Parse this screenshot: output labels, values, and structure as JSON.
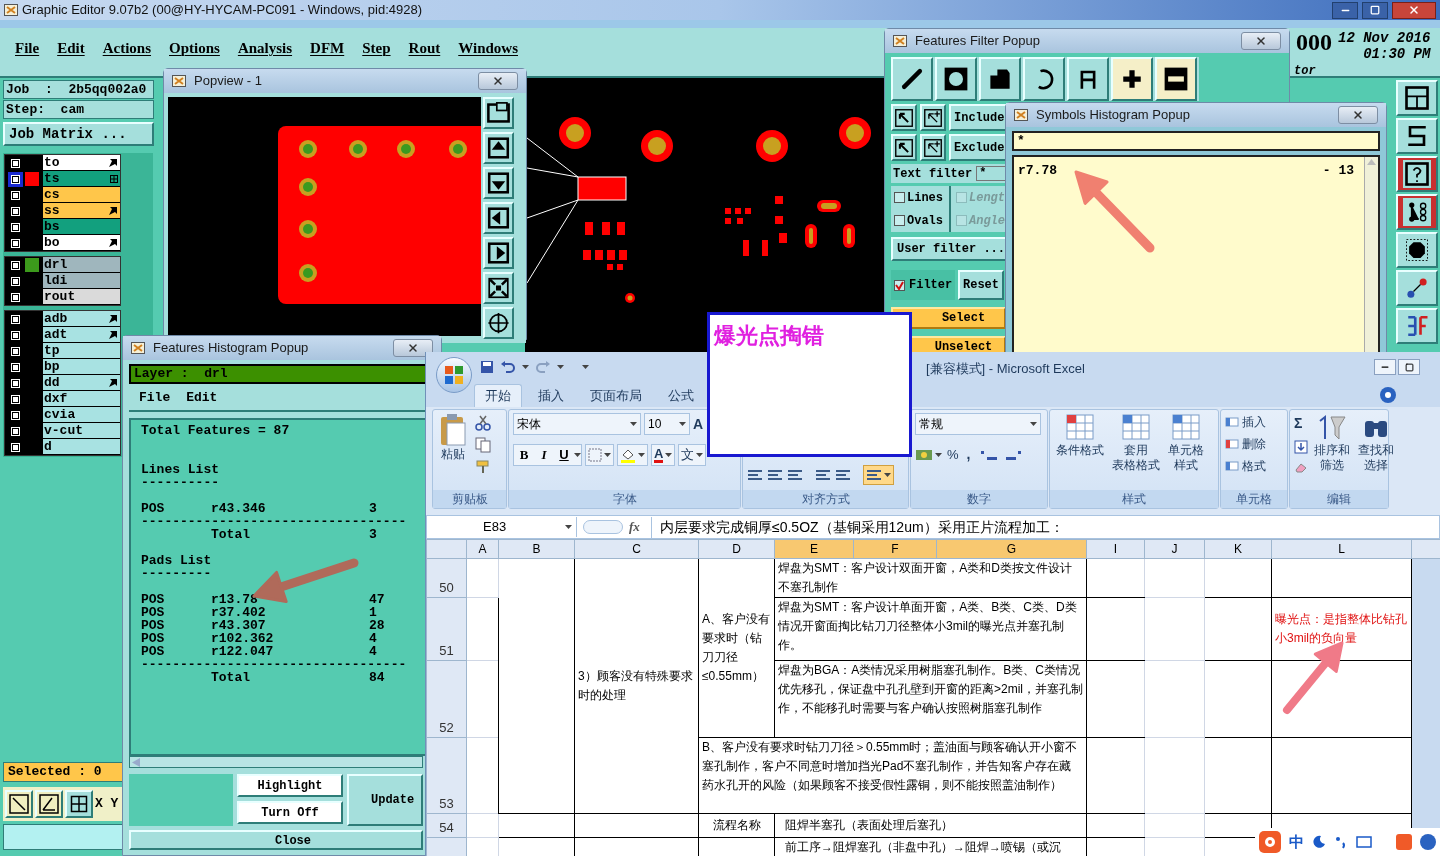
{
  "main_window": {
    "title": "Graphic Editor 9.07b2 (00@HY-HYCAM-PC091 - Windows, pid:4928)"
  },
  "menu": [
    "File",
    "Edit",
    "Actions",
    "Options",
    "Analysis",
    "DFM",
    "Step",
    "Rout",
    "Windows"
  ],
  "header_info": {
    "counter": "000",
    "date": "12 Nov 2016",
    "time": "01:30 PM",
    "label": "tor"
  },
  "job": {
    "job": "Job  :  2b5qq002a0",
    "step": "Step:  cam",
    "matrix_button": "Job Matrix ..."
  },
  "layer_groups": [
    [
      {
        "name": "to",
        "color": "#ffffff",
        "selected": false,
        "marker": {
          "kind": "pointer"
        }
      },
      {
        "name": "ts",
        "color": "#12a07e",
        "selected": true,
        "swatch": {
          "color": "#ff0000"
        },
        "marker": {
          "kind": "grid"
        }
      },
      {
        "name": "cs",
        "color": "#ffc64a",
        "selected": false
      },
      {
        "name": "ss",
        "color": "#ffc64a",
        "selected": false,
        "marker": {
          "kind": "pointer"
        }
      },
      {
        "name": "bs",
        "color": "#12a07e",
        "selected": false
      },
      {
        "name": "bo",
        "color": "#ffffff",
        "selected": false,
        "marker": {
          "kind": "pointer"
        }
      }
    ],
    [
      {
        "name": "drl",
        "color": "#9fb6bd",
        "selected": false,
        "swatch": {
          "color": "#3c9a1c"
        }
      },
      {
        "name": "ldi",
        "color": "#9fb6bd",
        "selected": false
      },
      {
        "name": "rout",
        "color": "#dadada",
        "selected": false
      }
    ],
    [
      {
        "name": "adb",
        "color": "#a8e2e2",
        "selected": false,
        "marker": {
          "kind": "pointer"
        }
      },
      {
        "name": "adt",
        "color": "#a8e2e2",
        "selected": false,
        "marker": {
          "kind": "pointer"
        }
      },
      {
        "name": "tp",
        "color": "#a8e2e2",
        "selected": false
      },
      {
        "name": "bp",
        "color": "#a8e2e2",
        "selected": false
      },
      {
        "name": "dd",
        "color": "#a8e2e2",
        "selected": false,
        "marker": {
          "kind": "pointer"
        }
      },
      {
        "name": "dxf",
        "color": "#a8e2e2",
        "selected": false
      },
      {
        "name": "cvia",
        "color": "#a8e2e2",
        "selected": false
      },
      {
        "name": "v-cut",
        "color": "#a8e2e2",
        "selected": false
      },
      {
        "name": "d",
        "color": "#a8e2e2",
        "selected": false
      }
    ]
  ],
  "selected_count": "Selected : 0",
  "coord_label": "X Y",
  "popview": {
    "title": "Popview - 1"
  },
  "features_filter": {
    "title": "Features Filter Popup",
    "include": "Include",
    "exclude": "Exclude",
    "text_filter_label": "Text filter",
    "text_filter_value": "*",
    "type_checks": [
      {
        "label": "Lines",
        "checked": false
      },
      {
        "label": "Ovals",
        "checked": false
      }
    ],
    "attr_checks": [
      {
        "label": "Lengt",
        "checked": false,
        "disabled": true
      },
      {
        "label": "Angle",
        "checked": false,
        "disabled": true
      }
    ],
    "user_filter": "User filter ...",
    "filter": {
      "label": "Filter",
      "checked": true
    },
    "reset": "Reset",
    "select": "Select",
    "unselect": "Unselect"
  },
  "symbols_histogram": {
    "title": "Symbols Histogram Popup",
    "filter_value": "*",
    "items": [
      {
        "symbol": "r7.78",
        "count": "- 13"
      }
    ]
  },
  "features_histogram": {
    "title": "Features Histogram Popup",
    "layer": "Layer :  drl",
    "menu": [
      "File",
      "Edit"
    ],
    "total_features": "Total Features = 87",
    "sections": [
      {
        "title": "Lines List",
        "underline": "----------",
        "rows": [
          {
            "type": "POS",
            "symbol": "r43.346",
            "count": "3"
          }
        ],
        "rule": "----------------------------------",
        "total_label": "Total",
        "total": "3"
      },
      {
        "title": "Pads List",
        "underline": "---------",
        "rows": [
          {
            "type": "POS",
            "symbol": "r13.78",
            "count": "47"
          },
          {
            "type": "POS",
            "symbol": "r37.402",
            "count": "1"
          },
          {
            "type": "POS",
            "symbol": "r43.307",
            "count": "28"
          },
          {
            "type": "POS",
            "symbol": "r102.362",
            "count": "4"
          },
          {
            "type": "POS",
            "symbol": "r122.047",
            "count": "4"
          }
        ],
        "rule": "----------------------------------",
        "total_label": "Total",
        "total": "84"
      }
    ],
    "highlight": "Highlight",
    "turn_off": "Turn Off",
    "update": "Update",
    "close": "Close"
  },
  "note_box": {
    "text": "爆光点掏错"
  },
  "excel": {
    "title": "[兼容模式] - Microsoft Excel",
    "tabs": [
      {
        "label": "开始",
        "selected": true
      },
      {
        "label": "插入",
        "selected": false
      },
      {
        "label": "页面布局",
        "selected": false
      },
      {
        "label": "公式",
        "selected": false
      }
    ],
    "clipboard": {
      "label": "剪贴板",
      "paste": "粘贴"
    },
    "font": {
      "label": "字体",
      "name": "宋体",
      "size": "10",
      "grow": "A",
      "bold": "B",
      "italic": "I",
      "underline": "U",
      "color_button": "A",
      "phonetic": "文"
    },
    "alignment": {
      "label": "对齐方式"
    },
    "number": {
      "label": "数字",
      "format": "常规",
      "percent": "%",
      "comma": ","
    },
    "styles": {
      "label": "样式",
      "buttons": [
        [
          "条件格式"
        ],
        [
          "套用",
          "表格格式"
        ],
        [
          "单元格",
          "样式"
        ]
      ]
    },
    "cells": {
      "label": "单元格",
      "buttons": [
        "插入",
        "删除",
        "格式"
      ]
    },
    "editing": {
      "label": "编辑",
      "sum": "Σ",
      "buttons": [
        [
          "排序和",
          "筛选"
        ],
        [
          "查找和",
          "选择"
        ]
      ]
    },
    "cell_ref": "E83",
    "fx": "fx",
    "formula": "内层要求完成铜厚≤0.5OZ（基铜采用12um）采用正片流程加工：",
    "columns": [
      {
        "label": "A",
        "highlighted": false
      },
      {
        "label": "B",
        "highlighted": false
      },
      {
        "label": "C",
        "highlighted": false
      },
      {
        "label": "D",
        "highlighted": false
      },
      {
        "label": "E",
        "highlighted": true
      },
      {
        "label": "F",
        "highlighted": true
      },
      {
        "label": "G",
        "highlighted": true
      },
      {
        "label": "I",
        "highlighted": false
      },
      {
        "label": "J",
        "highlighted": false
      },
      {
        "label": "K",
        "highlighted": false
      },
      {
        "label": "L",
        "highlighted": false
      }
    ],
    "row_numbers": [
      "50",
      "51",
      "52",
      "53",
      "54"
    ],
    "c_merged": "3）顾客没有特殊要求时的处理",
    "d_merged": "A、客户没有要求时（钻刀刀径≤0.55mm）",
    "e_rows": [
      "焊盘为SMT：客户设计双面开窗，A类和D类按文件设计不塞孔制作",
      "焊盘为SMT：客户设计单面开窗，A类、B类、C类、D类情况开窗面掏比钻刀刀径整体小3mil的曝光点并塞孔制作。",
      "焊盘为BGA：A类情况采用树脂塞孔制作。B类、C类情况优先移孔，保证盘中孔孔壁到开窗的距离>2mil，并塞孔制作，不能移孔时需要与客户确认按照树脂塞孔制作"
    ],
    "row53": "B、客户没有要求时钻刀刀径＞0.55mm时；盖油面与顾客确认开小窗不塞孔制作，客户不同意时增加挡光Pad不塞孔制作，并告知客户存在藏药水孔开的风险（如果顾客不接受假性露铜，则不能按照盖油制作）",
    "note51": "曝光点：是指整体比钻孔小3mil的负向量",
    "row54": {
      "d": "流程名称",
      "e": "阻焊半塞孔（表面处理后塞孔）"
    },
    "row55": {
      "e": "前工序→阻焊塞孔（非盘中孔）→阻焊→喷锡（或沉"
    }
  },
  "ime_bar": {
    "mode": "中"
  }
}
